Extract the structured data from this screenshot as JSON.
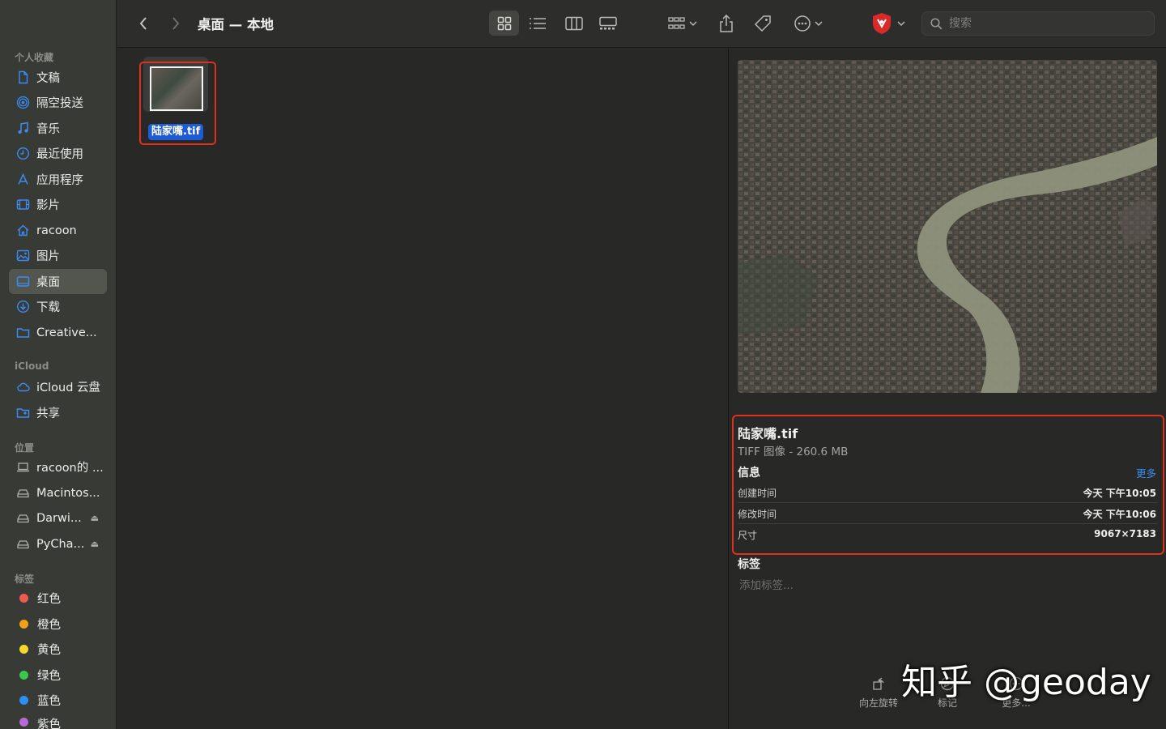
{
  "window": {
    "title": "桌面 — 本地"
  },
  "sidebar": {
    "favorites_header": "个人收藏",
    "favorites": [
      {
        "label": "文稿",
        "icon": "document-icon"
      },
      {
        "label": "隔空投送",
        "icon": "airdrop-icon"
      },
      {
        "label": "音乐",
        "icon": "music-icon"
      },
      {
        "label": "最近使用",
        "icon": "clock-icon"
      },
      {
        "label": "应用程序",
        "icon": "apps-icon"
      },
      {
        "label": "影片",
        "icon": "film-icon"
      },
      {
        "label": "racoon",
        "icon": "home-icon"
      },
      {
        "label": "图片",
        "icon": "photo-icon"
      },
      {
        "label": "桌面",
        "icon": "desktop-icon",
        "selected": true
      },
      {
        "label": "下载",
        "icon": "download-icon"
      },
      {
        "label": "Creative...",
        "icon": "folder-icon"
      }
    ],
    "icloud_header": "iCloud",
    "icloud": [
      {
        "label": "iCloud 云盘",
        "icon": "cloud-icon"
      },
      {
        "label": "共享",
        "icon": "shared-folder-icon"
      }
    ],
    "locations_header": "位置",
    "locations": [
      {
        "label": "racoon的 ...",
        "icon": "laptop-icon",
        "eject": false
      },
      {
        "label": "Macintos...",
        "icon": "disk-icon",
        "eject": false
      },
      {
        "label": "Darwi...",
        "icon": "disk-icon",
        "eject": true
      },
      {
        "label": "PyCha...",
        "icon": "disk-icon",
        "eject": true
      }
    ],
    "tags_header": "标签",
    "tags": [
      {
        "label": "红色",
        "color": "#ef5a4f"
      },
      {
        "label": "橙色",
        "color": "#f3a019"
      },
      {
        "label": "黄色",
        "color": "#f6d72b"
      },
      {
        "label": "绿色",
        "color": "#39c84c"
      },
      {
        "label": "蓝色",
        "color": "#2b8ff5"
      },
      {
        "label": "紫色",
        "color": "#b86ad9"
      }
    ]
  },
  "toolbar": {
    "search_placeholder": "搜索",
    "active_view": "icon-view"
  },
  "files": [
    {
      "name": "陆家嘴.tif",
      "selected": true
    }
  ],
  "preview": {
    "file_name": "陆家嘴.tif",
    "kind_size": "TIFF 图像 - 260.6 MB",
    "info_header": "信息",
    "more_link": "更多",
    "rows": [
      {
        "label": "创建时间",
        "value": "今天 下午10:05"
      },
      {
        "label": "修改时间",
        "value": "今天 下午10:06"
      },
      {
        "label": "尺寸",
        "value": "9067×7183"
      }
    ],
    "tags_header": "标签",
    "tags_placeholder": "添加标签...",
    "actions": [
      {
        "label": "向左旋转",
        "icon": "rotate-left-icon"
      },
      {
        "label": "标记",
        "icon": "markup-icon"
      },
      {
        "label": "更多...",
        "icon": "more-icon"
      }
    ]
  },
  "watermark": "知乎 @geoday",
  "colors": {
    "highlight": "#e0301e",
    "selection": "#1e5bd6",
    "link": "#3b8cf5"
  }
}
